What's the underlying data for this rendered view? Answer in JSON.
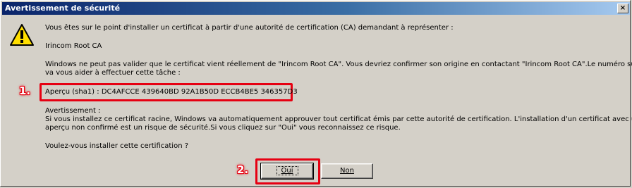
{
  "window": {
    "title": "Avertissement de sécurité",
    "close_glyph": "×"
  },
  "message": {
    "intro": "Vous êtes sur le point d'installer un certificat à partir d'une autorité de certification (CA) demandant à représenter :",
    "ca_name": "Irincom Root CA",
    "warning_line1": "Windows ne peut pas valider que le certificat vient réellement de \"Irincom Root CA\". Vous devriez confirmer son origine en contactant \"Irincom Root CA\".Le numéro suivant",
    "warning_line2": "va vous aider à effectuer cette tâche :",
    "thumbprint": "Aperçu (sha1) : DC4AFCCE 439640BD 92A1B50D ECCB4BE5 346357D3",
    "avert_title": "Avertissement :",
    "avert_line1": "Si vous installez ce certificat racine, Windows va automatiquement approuver tout certificat émis par cette autorité de certification. L'installation d'un certificat avec un",
    "avert_line2": "aperçu non confirmé est un risque de sécurité.Si vous cliquez sur \"Oui\" vous reconnaissez ce risque.",
    "question": "Voulez-vous installer cette certification ?"
  },
  "buttons": {
    "yes": "Oui",
    "no": "Non"
  },
  "annotations": {
    "step1": "1.",
    "step2": "2."
  },
  "colors": {
    "callout": "#e60012",
    "titlebar_start": "#0a246a",
    "titlebar_end": "#a6caf0"
  },
  "icons": {
    "warning": "warning-icon"
  }
}
